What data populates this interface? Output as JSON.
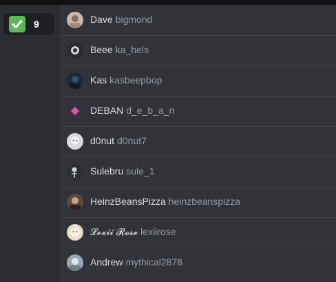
{
  "reaction": {
    "emoji": "white-check-mark-icon",
    "count": "9",
    "color": "#5cb85c"
  },
  "reactors": [
    {
      "display_name": "Dave",
      "username": "bigmond",
      "avatar_color": "#c9b8b0"
    },
    {
      "display_name": "Beee",
      "username": "ka_hels",
      "avatar_color": "#2a2a30"
    },
    {
      "display_name": "Kas",
      "username": "kasbeepbop",
      "avatar_color": "#1b2a3a"
    },
    {
      "display_name": "DEBAN",
      "username": "d_e_b_a_n",
      "avatar_color": "#3a2f5a"
    },
    {
      "display_name": "d0nut",
      "username": "d0nut7",
      "avatar_color": "#d8d8e0"
    },
    {
      "display_name": "Sulebru",
      "username": "sule_1",
      "avatar_color": "#2c2f34"
    },
    {
      "display_name": "HeinzBeansPizza",
      "username": "heinzbeanspizza",
      "avatar_color": "#5a4a3e"
    },
    {
      "display_name": "𝓛𝓮𝔁𝓲𝓲 𝓡𝓸𝓼𝓮",
      "username": "lexiirose",
      "avatar_color": "#e8dcc8"
    },
    {
      "display_name": "Andrew",
      "username": "mythical2878",
      "avatar_color": "#9aa8b6"
    }
  ]
}
